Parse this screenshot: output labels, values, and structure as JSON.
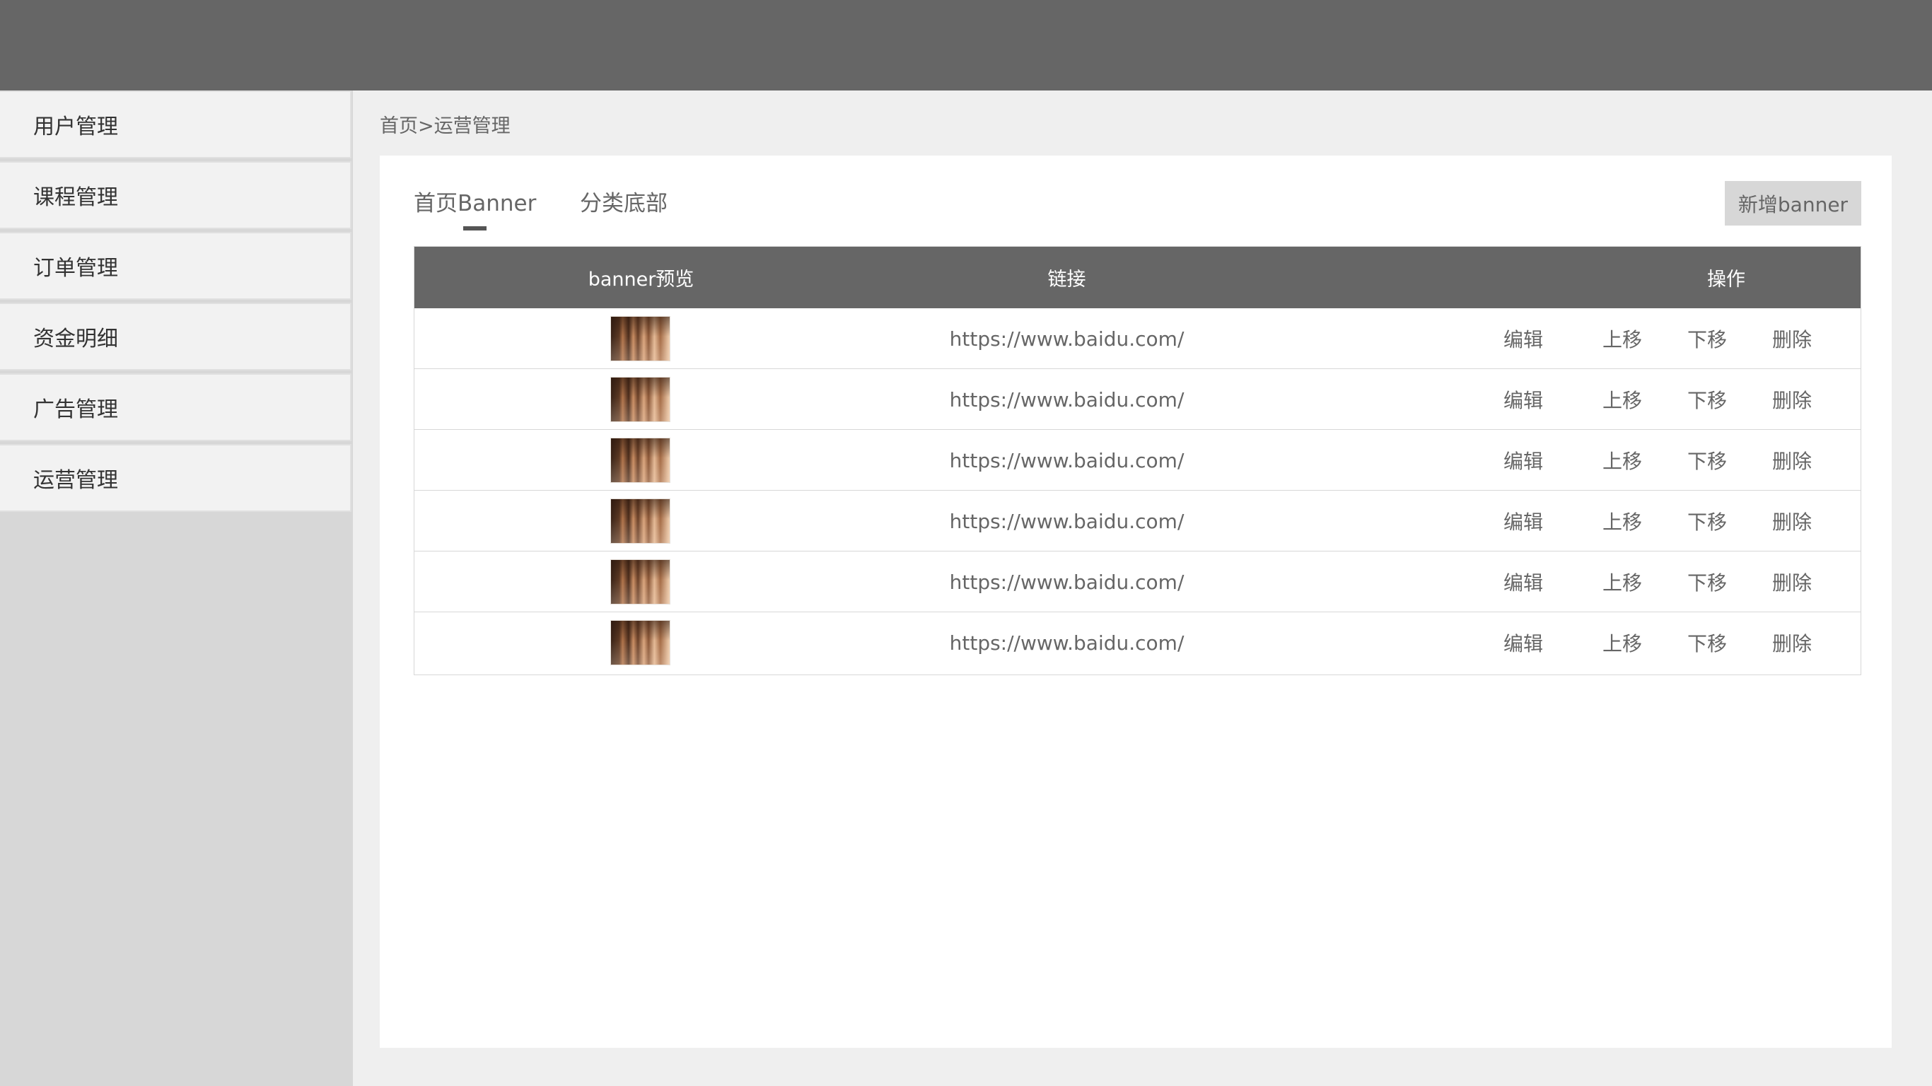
{
  "sidebar": {
    "items": [
      {
        "label": "用户管理"
      },
      {
        "label": "课程管理"
      },
      {
        "label": "订单管理"
      },
      {
        "label": "资金明细"
      },
      {
        "label": "广告管理"
      },
      {
        "label": "运营管理"
      }
    ]
  },
  "breadcrumb": "首页>运营管理",
  "tabs": [
    {
      "label": "首页Banner",
      "active": true
    },
    {
      "label": "分类底部",
      "active": false
    }
  ],
  "add_button_label": "新增banner",
  "table": {
    "columns": [
      "banner预览",
      "链接",
      "操作"
    ],
    "rows": [
      {
        "link": "https://www.baidu.com/",
        "actions": [
          "编辑",
          "上移",
          "下移",
          "删除"
        ]
      },
      {
        "link": "https://www.baidu.com/",
        "actions": [
          "编辑",
          "上移",
          "下移",
          "删除"
        ]
      },
      {
        "link": "https://www.baidu.com/",
        "actions": [
          "编辑",
          "上移",
          "下移",
          "删除"
        ]
      },
      {
        "link": "https://www.baidu.com/",
        "actions": [
          "编辑",
          "上移",
          "下移",
          "删除"
        ]
      },
      {
        "link": "https://www.baidu.com/",
        "actions": [
          "编辑",
          "上移",
          "下移",
          "删除"
        ]
      },
      {
        "link": "https://www.baidu.com/",
        "actions": [
          "编辑",
          "上移",
          "下移",
          "删除"
        ]
      }
    ]
  },
  "colors": {
    "header_bg": "#666666",
    "sidebar_bg": "#d7d7d7",
    "page_bg": "#efefef",
    "button_bg": "#d7d7d7"
  }
}
